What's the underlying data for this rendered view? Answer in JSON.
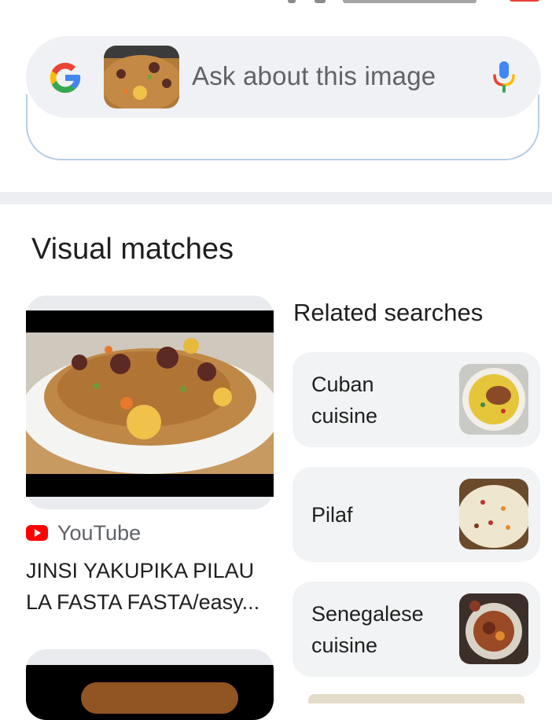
{
  "search": {
    "placeholder": "Ask about this image",
    "logo_icon": "google-g-icon",
    "mic_icon": "microphone-icon"
  },
  "visual_matches": {
    "title": "Visual matches",
    "items": [
      {
        "source": "YouTube",
        "source_icon": "youtube-icon",
        "title": "JINSI YAKUPIKA PILAU LA FASTA FASTA/easy..."
      }
    ]
  },
  "related": {
    "title": "Related searches",
    "items": [
      {
        "label": "Cuban cuisine"
      },
      {
        "label": "Pilaf"
      },
      {
        "label": "Senegalese cuisine"
      }
    ]
  },
  "colors": {
    "google_blue": "#4285F4",
    "google_red": "#EA4335",
    "google_yellow": "#FBBC05",
    "google_green": "#34A853",
    "youtube_red": "#FF0000"
  }
}
